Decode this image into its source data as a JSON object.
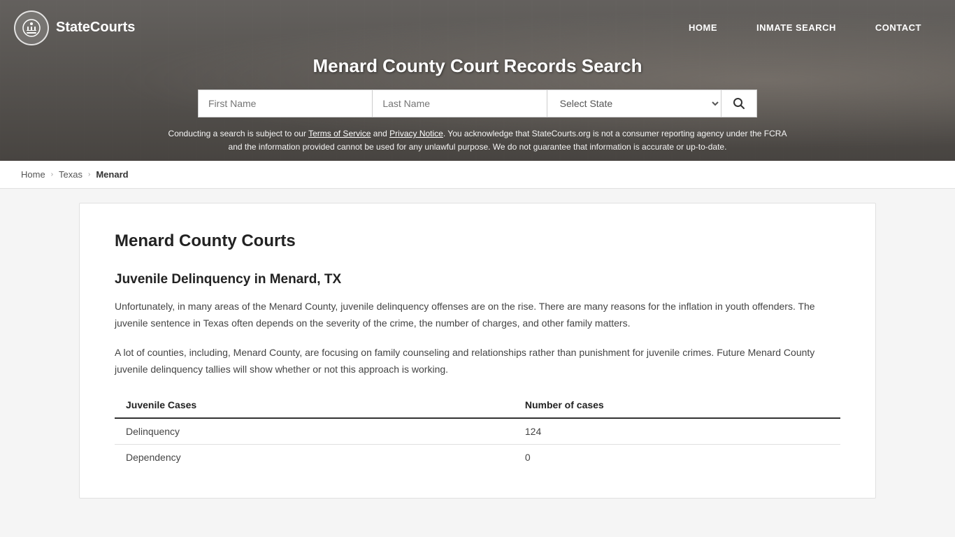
{
  "site": {
    "logo_text": "StateCourts",
    "logo_icon": "⊙"
  },
  "nav": {
    "home_label": "HOME",
    "inmate_search_label": "INMATE SEARCH",
    "contact_label": "CONTACT"
  },
  "header": {
    "page_title": "Menard County Court Records Search",
    "search": {
      "first_name_placeholder": "First Name",
      "last_name_placeholder": "Last Name",
      "state_placeholder": "Select State",
      "search_icon": "🔍"
    },
    "disclaimer": {
      "text_before_tos": "Conducting a search is subject to our ",
      "tos_label": "Terms of Service",
      "text_between": " and ",
      "privacy_label": "Privacy Notice",
      "text_after": ". You acknowledge that StateCourts.org is not a consumer reporting agency under the FCRA and the information provided cannot be used for any unlawful purpose. We do not guarantee that information is accurate or up-to-date."
    }
  },
  "breadcrumb": {
    "home_label": "Home",
    "state_label": "Texas",
    "county_label": "Menard"
  },
  "content": {
    "main_heading": "Menard County Courts",
    "section_heading": "Juvenile Delinquency in Menard, TX",
    "paragraph1": "Unfortunately, in many areas of the Menard County, juvenile delinquency offenses are on the rise. There are many reasons for the inflation in youth offenders. The juvenile sentence in Texas often depends on the severity of the crime, the number of charges, and other family matters.",
    "paragraph2": "A lot of counties, including, Menard County, are focusing on family counseling and relationships rather than punishment for juvenile crimes. Future Menard County juvenile delinquency tallies will show whether or not this approach is working.",
    "table": {
      "col1_header": "Juvenile Cases",
      "col2_header": "Number of cases",
      "rows": [
        {
          "case_type": "Delinquency",
          "count": "124"
        },
        {
          "case_type": "Dependency",
          "count": "0"
        }
      ]
    }
  }
}
